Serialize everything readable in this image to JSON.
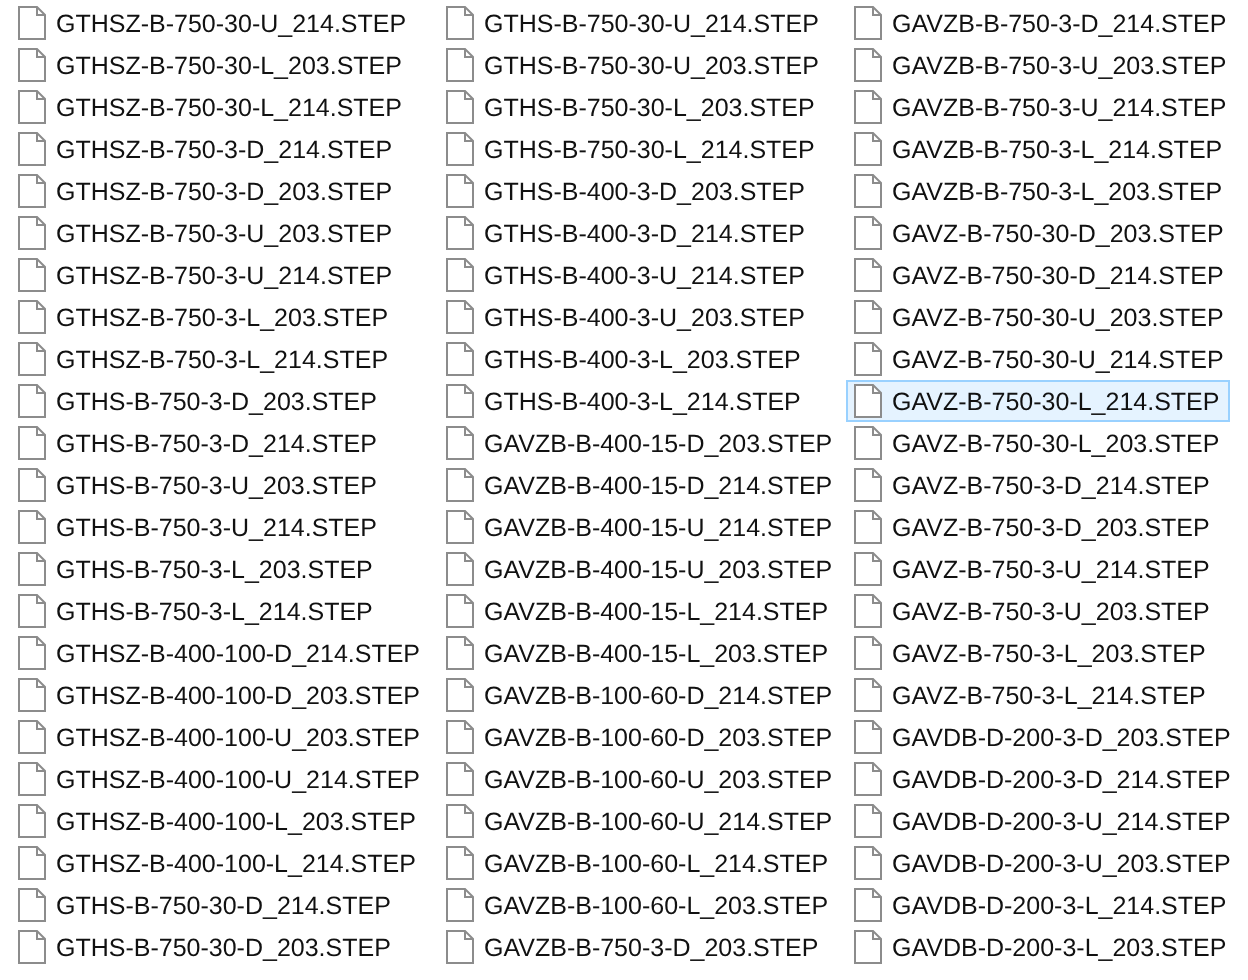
{
  "files": [
    {
      "name": "GTHSZ-B-750-30-U_214.STEP",
      "selected": false
    },
    {
      "name": "GTHSZ-B-750-30-L_203.STEP",
      "selected": false
    },
    {
      "name": "GTHSZ-B-750-30-L_214.STEP",
      "selected": false
    },
    {
      "name": "GTHSZ-B-750-3-D_214.STEP",
      "selected": false
    },
    {
      "name": "GTHSZ-B-750-3-D_203.STEP",
      "selected": false
    },
    {
      "name": "GTHSZ-B-750-3-U_203.STEP",
      "selected": false
    },
    {
      "name": "GTHSZ-B-750-3-U_214.STEP",
      "selected": false
    },
    {
      "name": "GTHSZ-B-750-3-L_203.STEP",
      "selected": false
    },
    {
      "name": "GTHSZ-B-750-3-L_214.STEP",
      "selected": false
    },
    {
      "name": "GTHS-B-750-3-D_203.STEP",
      "selected": false
    },
    {
      "name": "GTHS-B-750-3-D_214.STEP",
      "selected": false
    },
    {
      "name": "GTHS-B-750-3-U_203.STEP",
      "selected": false
    },
    {
      "name": "GTHS-B-750-3-U_214.STEP",
      "selected": false
    },
    {
      "name": "GTHS-B-750-3-L_203.STEP",
      "selected": false
    },
    {
      "name": "GTHS-B-750-3-L_214.STEP",
      "selected": false
    },
    {
      "name": "GTHSZ-B-400-100-D_214.STEP",
      "selected": false
    },
    {
      "name": "GTHSZ-B-400-100-D_203.STEP",
      "selected": false
    },
    {
      "name": "GTHSZ-B-400-100-U_203.STEP",
      "selected": false
    },
    {
      "name": "GTHSZ-B-400-100-U_214.STEP",
      "selected": false
    },
    {
      "name": "GTHSZ-B-400-100-L_203.STEP",
      "selected": false
    },
    {
      "name": "GTHSZ-B-400-100-L_214.STEP",
      "selected": false
    },
    {
      "name": "GTHS-B-750-30-D_214.STEP",
      "selected": false
    },
    {
      "name": "GTHS-B-750-30-D_203.STEP",
      "selected": false
    },
    {
      "name": "GTHS-B-750-30-U_214.STEP",
      "selected": false
    },
    {
      "name": "GTHS-B-750-30-U_203.STEP",
      "selected": false
    },
    {
      "name": "GTHS-B-750-30-L_203.STEP",
      "selected": false
    },
    {
      "name": "GTHS-B-750-30-L_214.STEP",
      "selected": false
    },
    {
      "name": "GTHS-B-400-3-D_203.STEP",
      "selected": false
    },
    {
      "name": "GTHS-B-400-3-D_214.STEP",
      "selected": false
    },
    {
      "name": "GTHS-B-400-3-U_214.STEP",
      "selected": false
    },
    {
      "name": "GTHS-B-400-3-U_203.STEP",
      "selected": false
    },
    {
      "name": "GTHS-B-400-3-L_203.STEP",
      "selected": false
    },
    {
      "name": "GTHS-B-400-3-L_214.STEP",
      "selected": false
    },
    {
      "name": "GAVZB-B-400-15-D_203.STEP",
      "selected": false
    },
    {
      "name": "GAVZB-B-400-15-D_214.STEP",
      "selected": false
    },
    {
      "name": "GAVZB-B-400-15-U_214.STEP",
      "selected": false
    },
    {
      "name": "GAVZB-B-400-15-U_203.STEP",
      "selected": false
    },
    {
      "name": "GAVZB-B-400-15-L_214.STEP",
      "selected": false
    },
    {
      "name": "GAVZB-B-400-15-L_203.STEP",
      "selected": false
    },
    {
      "name": "GAVZB-B-100-60-D_214.STEP",
      "selected": false
    },
    {
      "name": "GAVZB-B-100-60-D_203.STEP",
      "selected": false
    },
    {
      "name": "GAVZB-B-100-60-U_203.STEP",
      "selected": false
    },
    {
      "name": "GAVZB-B-100-60-U_214.STEP",
      "selected": false
    },
    {
      "name": "GAVZB-B-100-60-L_214.STEP",
      "selected": false
    },
    {
      "name": "GAVZB-B-100-60-L_203.STEP",
      "selected": false
    },
    {
      "name": "GAVZB-B-750-3-D_203.STEP",
      "selected": false
    },
    {
      "name": "GAVZB-B-750-3-D_214.STEP",
      "selected": false
    },
    {
      "name": "GAVZB-B-750-3-U_203.STEP",
      "selected": false
    },
    {
      "name": "GAVZB-B-750-3-U_214.STEP",
      "selected": false
    },
    {
      "name": "GAVZB-B-750-3-L_214.STEP",
      "selected": false
    },
    {
      "name": "GAVZB-B-750-3-L_203.STEP",
      "selected": false
    },
    {
      "name": "GAVZ-B-750-30-D_203.STEP",
      "selected": false
    },
    {
      "name": "GAVZ-B-750-30-D_214.STEP",
      "selected": false
    },
    {
      "name": "GAVZ-B-750-30-U_203.STEP",
      "selected": false
    },
    {
      "name": "GAVZ-B-750-30-U_214.STEP",
      "selected": false
    },
    {
      "name": "GAVZ-B-750-30-L_214.STEP",
      "selected": true
    },
    {
      "name": "GAVZ-B-750-30-L_203.STEP",
      "selected": false
    },
    {
      "name": "GAVZ-B-750-3-D_214.STEP",
      "selected": false
    },
    {
      "name": "GAVZ-B-750-3-D_203.STEP",
      "selected": false
    },
    {
      "name": "GAVZ-B-750-3-U_214.STEP",
      "selected": false
    },
    {
      "name": "GAVZ-B-750-3-U_203.STEP",
      "selected": false
    },
    {
      "name": "GAVZ-B-750-3-L_203.STEP",
      "selected": false
    },
    {
      "name": "GAVZ-B-750-3-L_214.STEP",
      "selected": false
    },
    {
      "name": "GAVDB-D-200-3-D_203.STEP",
      "selected": false
    },
    {
      "name": "GAVDB-D-200-3-D_214.STEP",
      "selected": false
    },
    {
      "name": "GAVDB-D-200-3-U_214.STEP",
      "selected": false
    },
    {
      "name": "GAVDB-D-200-3-U_203.STEP",
      "selected": false
    },
    {
      "name": "GAVDB-D-200-3-L_214.STEP",
      "selected": false
    },
    {
      "name": "GAVDB-D-200-3-L_203.STEP",
      "selected": false
    }
  ]
}
